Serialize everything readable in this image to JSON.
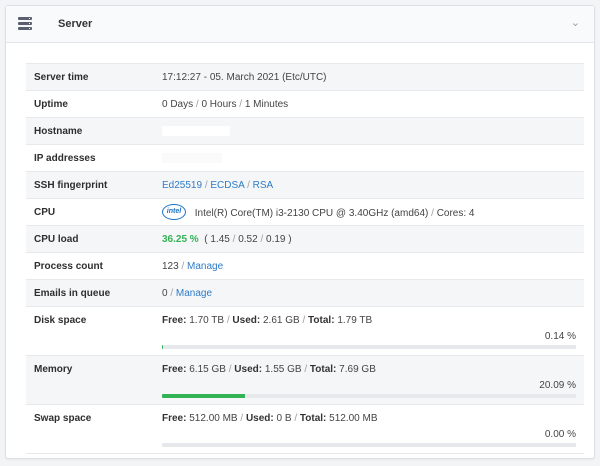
{
  "panel": {
    "title": "Server",
    "icon": "server-icon",
    "collapse_icon": "chevron-down-icon"
  },
  "rows": {
    "server_time": {
      "label": "Server time",
      "value": "17:12:27 - 05. March 2021 (Etc/UTC)"
    },
    "uptime": {
      "label": "Uptime",
      "days": "0 Days",
      "hours": "0 Hours",
      "minutes": "1 Minutes"
    },
    "hostname": {
      "label": "Hostname"
    },
    "ip": {
      "label": "IP addresses"
    },
    "ssh": {
      "label": "SSH fingerprint",
      "links": [
        "Ed25519",
        "ECDSA",
        "RSA"
      ]
    },
    "cpu": {
      "label": "CPU",
      "logo": "intel",
      "model": "Intel(R) Core(TM) i3-2130 CPU @ 3.40GHz (amd64)",
      "cores": "Cores: 4"
    },
    "cpu_load": {
      "label": "CPU load",
      "percent": "36.25 %",
      "open": "(",
      "l1": "1.45",
      "l2": "0.52",
      "l3": "0.19",
      "close": ")"
    },
    "process": {
      "label": "Process count",
      "count": "123",
      "link": "Manage"
    },
    "emails": {
      "label": "Emails in queue",
      "count": "0",
      "link": "Manage"
    },
    "disk": {
      "label": "Disk space",
      "free_label": "Free:",
      "free": "1.70 TB",
      "used_label": "Used:",
      "used": "2.61 GB",
      "total_label": "Total:",
      "total": "1.79 TB",
      "percent": "0.14 %",
      "fill": 0.0014
    },
    "memory": {
      "label": "Memory",
      "free_label": "Free:",
      "free": "6.15 GB",
      "used_label": "Used:",
      "used": "1.55 GB",
      "total_label": "Total:",
      "total": "7.69 GB",
      "percent": "20.09 %",
      "fill": 0.2009
    },
    "swap": {
      "label": "Swap space",
      "free_label": "Free:",
      "free": "512.00 MB",
      "used_label": "Used:",
      "used": "0 B",
      "total_label": "Total:",
      "total": "512.00 MB",
      "percent": "0.00 %",
      "fill": 0.0
    }
  },
  "colors": {
    "accent_green": "#34b356",
    "link_blue": "#2e7bc6"
  }
}
